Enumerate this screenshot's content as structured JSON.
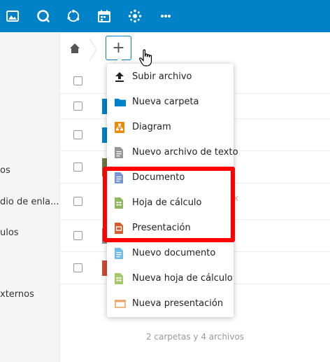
{
  "header": {
    "apps": [
      {
        "icon": "gallery-icon"
      },
      {
        "icon": "search-icon"
      },
      {
        "icon": "activity-icon"
      },
      {
        "icon": "calendar-icon"
      },
      {
        "icon": "settings-icon"
      },
      {
        "icon": "more-icon"
      }
    ],
    "accent_color": "#0082c9"
  },
  "sidebar": {
    "items": [
      {
        "label": "os"
      },
      {
        "label": "dio de enla..."
      },
      {
        "label": "ulos"
      },
      {
        "label": "xternos"
      }
    ]
  },
  "breadcrumb": {
    "home_icon": "home-icon",
    "add_label": "+"
  },
  "new_menu": {
    "items": [
      {
        "label": "Subir archivo",
        "icon": "upload-icon"
      },
      {
        "label": "Nueva carpeta",
        "icon": "folder-icon"
      },
      {
        "label": "Diagram",
        "icon": "diagram-icon"
      },
      {
        "label": "Nuevo archivo de texto",
        "icon": "text-file-icon"
      },
      {
        "label": "Documento",
        "icon": "document-icon"
      },
      {
        "label": "Hoja de cálculo",
        "icon": "spreadsheet-icon"
      },
      {
        "label": "Presentación",
        "icon": "presentation-icon"
      },
      {
        "label": "Nuevo documento",
        "icon": "new-document-icon"
      },
      {
        "label": "Nueva hoja de cálculo",
        "icon": "new-spreadsheet-icon"
      },
      {
        "label": "Nueva presentación",
        "icon": "new-presentation-icon"
      }
    ]
  },
  "file_list": {
    "trailing_mark": "x",
    "summary": "2 carpetas y 4 archivos"
  },
  "highlight_color": "#ff0000"
}
